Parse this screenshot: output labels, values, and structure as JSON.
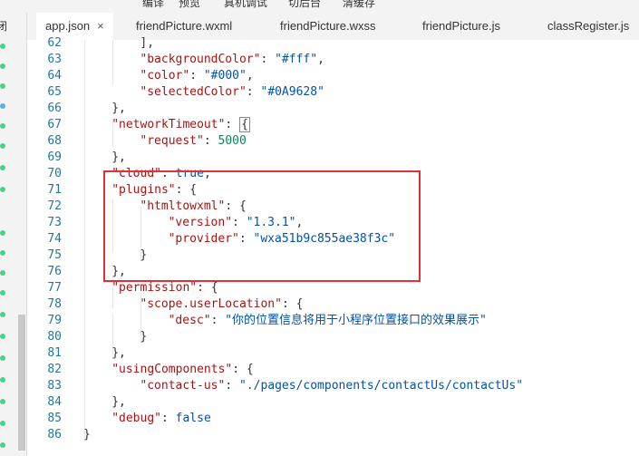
{
  "toolbar": {
    "items": [
      "编译",
      "预览",
      "真机调试",
      "切后台",
      "清缓存"
    ]
  },
  "sidebar": {
    "cut_label": "闭"
  },
  "tabs": [
    {
      "label": "app.json",
      "active": true,
      "close": "×"
    },
    {
      "label": "friendPicture.wxml"
    },
    {
      "label": "friendPicture.wxss"
    },
    {
      "label": "friendPicture.js"
    },
    {
      "label": "classRegister.js"
    }
  ],
  "lines": [
    {
      "n": "62",
      "indent": 2,
      "parts": [
        [
          "p",
          "],"
        ]
      ]
    },
    {
      "n": "63",
      "indent": 2,
      "parts": [
        [
          "k",
          "\"backgroundColor\""
        ],
        [
          "p",
          ": "
        ],
        [
          "s",
          "\"#fff\""
        ],
        [
          "p",
          ","
        ]
      ]
    },
    {
      "n": "64",
      "indent": 2,
      "parts": [
        [
          "k",
          "\"color\""
        ],
        [
          "p",
          ": "
        ],
        [
          "s",
          "\"#000\""
        ],
        [
          "p",
          ","
        ]
      ]
    },
    {
      "n": "65",
      "indent": 2,
      "parts": [
        [
          "k",
          "\"selectedColor\""
        ],
        [
          "p",
          ": "
        ],
        [
          "s",
          "\"#0A9628\""
        ]
      ]
    },
    {
      "n": "66",
      "indent": 1,
      "parts": [
        [
          "p",
          "},"
        ]
      ]
    },
    {
      "n": "67",
      "indent": 1,
      "parts": [
        [
          "k",
          "\"networkTimeout\""
        ],
        [
          "p",
          ": "
        ],
        [
          "b",
          "{"
        ]
      ]
    },
    {
      "n": "68",
      "indent": 2,
      "parts": [
        [
          "k",
          "\"request\""
        ],
        [
          "p",
          ": "
        ],
        [
          "n",
          "5000"
        ]
      ]
    },
    {
      "n": "69",
      "indent": 1,
      "parts": [
        [
          "p",
          "},"
        ]
      ]
    },
    {
      "n": "70",
      "indent": 1,
      "parts": [
        [
          "k",
          "\"cloud\""
        ],
        [
          "p",
          ": "
        ],
        [
          "s",
          "true"
        ],
        [
          "p",
          ","
        ]
      ]
    },
    {
      "n": "71",
      "indent": 1,
      "parts": [
        [
          "k",
          "\"plugins\""
        ],
        [
          "p",
          ": {"
        ]
      ]
    },
    {
      "n": "72",
      "indent": 2,
      "parts": [
        [
          "k",
          "\"htmltowxml\""
        ],
        [
          "p",
          ": {"
        ]
      ]
    },
    {
      "n": "73",
      "indent": 3,
      "parts": [
        [
          "k",
          "\"version\""
        ],
        [
          "p",
          ": "
        ],
        [
          "s",
          "\"1.3.1\""
        ],
        [
          "p",
          ","
        ]
      ]
    },
    {
      "n": "74",
      "indent": 3,
      "parts": [
        [
          "k",
          "\"provider\""
        ],
        [
          "p",
          ": "
        ],
        [
          "s",
          "\"wxa51b9c855ae38f3c\""
        ]
      ]
    },
    {
      "n": "75",
      "indent": 2,
      "parts": [
        [
          "p",
          "}"
        ]
      ]
    },
    {
      "n": "76",
      "indent": 1,
      "parts": [
        [
          "p",
          "},"
        ]
      ]
    },
    {
      "n": "77",
      "indent": 1,
      "parts": [
        [
          "k",
          "\"permission\""
        ],
        [
          "p",
          ": {"
        ]
      ]
    },
    {
      "n": "78",
      "indent": 2,
      "parts": [
        [
          "k",
          "\"scope.userLocation\""
        ],
        [
          "p",
          ": {"
        ]
      ]
    },
    {
      "n": "79",
      "indent": 3,
      "parts": [
        [
          "k",
          "\"desc\""
        ],
        [
          "p",
          ": "
        ],
        [
          "s",
          "\"你的位置信息将用于小程序位置接口的效果展示\""
        ]
      ]
    },
    {
      "n": "80",
      "indent": 2,
      "parts": [
        [
          "p",
          "}"
        ]
      ]
    },
    {
      "n": "81",
      "indent": 1,
      "parts": [
        [
          "p",
          "},"
        ]
      ]
    },
    {
      "n": "82",
      "indent": 1,
      "parts": [
        [
          "k",
          "\"usingComponents\""
        ],
        [
          "p",
          ": {"
        ]
      ]
    },
    {
      "n": "83",
      "indent": 2,
      "parts": [
        [
          "k",
          "\"contact-us\""
        ],
        [
          "p",
          ": "
        ],
        [
          "s",
          "\"./pages/components/contactUs/contactUs\""
        ]
      ]
    },
    {
      "n": "84",
      "indent": 1,
      "parts": [
        [
          "p",
          "},"
        ]
      ]
    },
    {
      "n": "85",
      "indent": 1,
      "parts": [
        [
          "k",
          "\"debug\""
        ],
        [
          "p",
          ": "
        ],
        [
          "s",
          "false"
        ]
      ]
    },
    {
      "n": "86",
      "indent": 0,
      "parts": [
        [
          "p",
          "}"
        ]
      ]
    }
  ],
  "colors": {
    "key": "#a31515",
    "string": "#0451a5",
    "number": "#098658",
    "highlight_box": "#e0303a"
  }
}
